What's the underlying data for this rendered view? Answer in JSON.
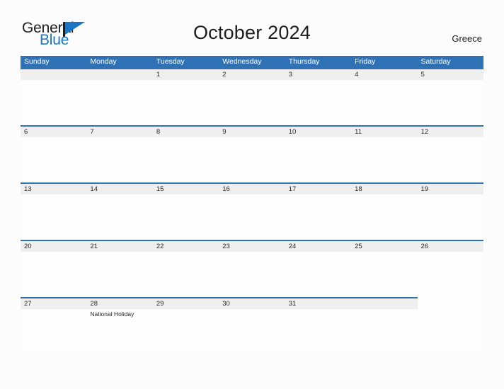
{
  "brand": {
    "word_one": "General",
    "word_two": "Blue",
    "accent_color": "#1a75c4",
    "dark_color": "#1d1d1d"
  },
  "header": {
    "title": "October 2024",
    "locale": "Greece"
  },
  "theme": {
    "header_blue": "#2e72b5",
    "band_gray": "#efefef",
    "page_background": "#fcfcfc"
  },
  "calendar": {
    "month": "October",
    "year": "2024",
    "weekdays": [
      "Sunday",
      "Monday",
      "Tuesday",
      "Wednesday",
      "Thursday",
      "Friday",
      "Saturday"
    ],
    "weeks": [
      [
        {
          "date": "",
          "event": "",
          "banded": true
        },
        {
          "date": "",
          "event": "",
          "banded": true
        },
        {
          "date": "1",
          "event": "",
          "banded": true
        },
        {
          "date": "2",
          "event": "",
          "banded": true
        },
        {
          "date": "3",
          "event": "",
          "banded": true
        },
        {
          "date": "4",
          "event": "",
          "banded": true
        },
        {
          "date": "5",
          "event": "",
          "banded": true
        }
      ],
      [
        {
          "date": "6",
          "event": "",
          "banded": true
        },
        {
          "date": "7",
          "event": "",
          "banded": true
        },
        {
          "date": "8",
          "event": "",
          "banded": true
        },
        {
          "date": "9",
          "event": "",
          "banded": true
        },
        {
          "date": "10",
          "event": "",
          "banded": true
        },
        {
          "date": "11",
          "event": "",
          "banded": true
        },
        {
          "date": "12",
          "event": "",
          "banded": true
        }
      ],
      [
        {
          "date": "13",
          "event": "",
          "banded": true
        },
        {
          "date": "14",
          "event": "",
          "banded": true
        },
        {
          "date": "15",
          "event": "",
          "banded": true
        },
        {
          "date": "16",
          "event": "",
          "banded": true
        },
        {
          "date": "17",
          "event": "",
          "banded": true
        },
        {
          "date": "18",
          "event": "",
          "banded": true
        },
        {
          "date": "19",
          "event": "",
          "banded": true
        }
      ],
      [
        {
          "date": "20",
          "event": "",
          "banded": true
        },
        {
          "date": "21",
          "event": "",
          "banded": true
        },
        {
          "date": "22",
          "event": "",
          "banded": true
        },
        {
          "date": "23",
          "event": "",
          "banded": true
        },
        {
          "date": "24",
          "event": "",
          "banded": true
        },
        {
          "date": "25",
          "event": "",
          "banded": true
        },
        {
          "date": "26",
          "event": "",
          "banded": true
        }
      ],
      [
        {
          "date": "27",
          "event": "",
          "banded": true
        },
        {
          "date": "28",
          "event": "National Holiday",
          "banded": true
        },
        {
          "date": "29",
          "event": "",
          "banded": true
        },
        {
          "date": "30",
          "event": "",
          "banded": true
        },
        {
          "date": "31",
          "event": "",
          "banded": true
        },
        {
          "date": "",
          "event": "",
          "banded": true
        },
        {
          "date": "",
          "event": "",
          "banded": false
        }
      ]
    ]
  }
}
